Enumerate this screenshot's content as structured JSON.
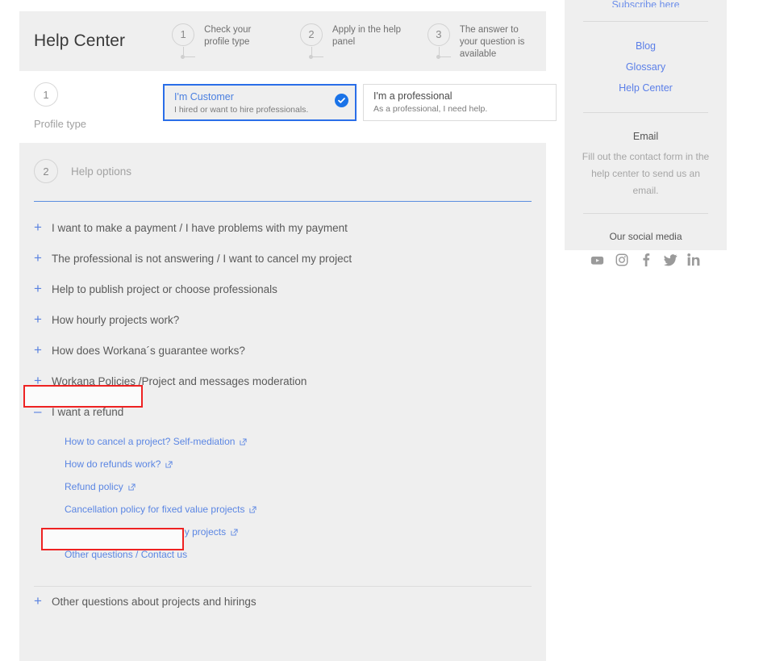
{
  "header": {
    "title": "Help Center",
    "steps": [
      {
        "number": "1",
        "text": "Check your profile type"
      },
      {
        "number": "2",
        "text": "Apply in the help panel"
      },
      {
        "number": "3",
        "text": "The answer to your question is available"
      }
    ]
  },
  "profile": {
    "step_number": "1",
    "step_label": "Profile type",
    "cards": [
      {
        "title": "I'm Customer",
        "subtitle": "I hired or want to hire professionals.",
        "selected": true
      },
      {
        "title": "I'm a professional",
        "subtitle": "As a professional, I need help.",
        "selected": false
      }
    ]
  },
  "help_options": {
    "step_number": "2",
    "step_label": "Help options",
    "items": [
      {
        "sign": "+",
        "label": "I want to make a payment / I have problems with my payment",
        "open": false
      },
      {
        "sign": "+",
        "label": "The professional is not answering / I want to cancel my project",
        "open": false
      },
      {
        "sign": "+",
        "label": "Help to publish project or choose professionals",
        "open": false
      },
      {
        "sign": "+",
        "label": "How hourly projects work?",
        "open": false
      },
      {
        "sign": "+",
        "label": "How does Workana´s guarantee works?",
        "open": false
      },
      {
        "sign": "+",
        "label": "Workana Policies /Project and messages moderation",
        "open": false
      },
      {
        "sign": "–",
        "label": "I want a refund",
        "open": true
      },
      {
        "sign": "+",
        "label": "Other questions about projects and hirings",
        "open": false
      }
    ],
    "refund_sublinks": [
      {
        "label": "How to cancel a project? Self-mediation",
        "external": true
      },
      {
        "label": "How do refunds work?",
        "external": true
      },
      {
        "label": "Refund policy",
        "external": true
      },
      {
        "label": "Cancellation policy for fixed value projects",
        "external": true
      },
      {
        "label": "Cancellation Policy for hourly projects",
        "external": true
      },
      {
        "label": "Other questions / Contact us",
        "external": false
      }
    ]
  },
  "sidebar": {
    "subscribe": "Subscribe here",
    "links": [
      "Blog",
      "Glossary",
      "Help Center"
    ],
    "email_title": "Email",
    "email_note": "Fill out the contact form in the help center to send us an email.",
    "social_title": "Our social media",
    "social": [
      "youtube-icon",
      "instagram-icon",
      "facebook-icon",
      "twitter-icon",
      "linkedin-icon"
    ]
  },
  "colors": {
    "accent_blue": "#5b7fe8",
    "selected_border": "#2a6ee8",
    "check_badge": "#1a73e8",
    "panel_bg": "#efefef",
    "annotation_red": "#ee2222"
  }
}
